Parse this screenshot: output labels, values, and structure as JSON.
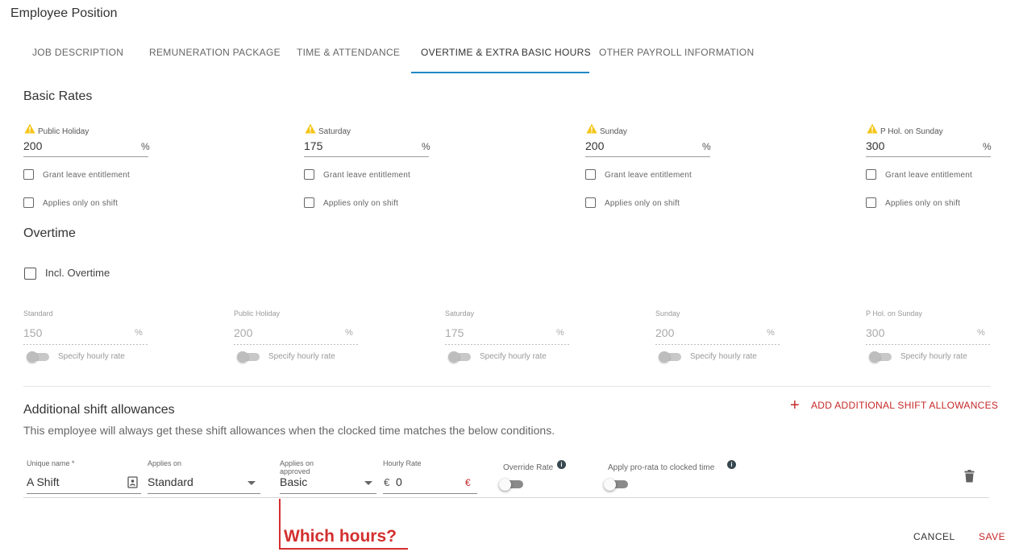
{
  "page": {
    "title": "Employee Position"
  },
  "tabs": [
    {
      "label": "JOB DESCRIPTION"
    },
    {
      "label": "REMUNERATION PACKAGE"
    },
    {
      "label": "TIME & ATTENDANCE"
    },
    {
      "label": "OVERTIME & EXTRA BASIC HOURS",
      "active": true
    },
    {
      "label": "OTHER PAYROLL INFORMATION"
    }
  ],
  "basic_rates": {
    "title": "Basic Rates",
    "unit": "%",
    "grant_label": "Grant leave entitlement",
    "shift_label": "Applies only on shift",
    "warning_icon": "warning-triangle-icon",
    "warning_color": "#f5c518",
    "fields": [
      {
        "label": "Public Holiday",
        "value": "200"
      },
      {
        "label": "Saturday",
        "value": "175"
      },
      {
        "label": "Sunday",
        "value": "200"
      },
      {
        "label": "P Hol. on Sunday",
        "value": "300"
      }
    ]
  },
  "overtime": {
    "title": "Overtime",
    "incl_label": "Incl. Overtime",
    "unit": "%",
    "toggle_label": "Specify hourly rate",
    "fields": [
      {
        "label": "Standard",
        "value": "150"
      },
      {
        "label": "Public Holiday",
        "value": "200"
      },
      {
        "label": "Saturday",
        "value": "175"
      },
      {
        "label": "Sunday",
        "value": "200"
      },
      {
        "label": "P Hol. on Sunday",
        "value": "300"
      }
    ]
  },
  "allowances": {
    "title": "Additional shift allowances",
    "description": "This employee will always get these shift allowances when the clocked time matches the below conditions.",
    "add_label": "ADD ADDITIONAL SHIFT ALLOWANCES",
    "accent_color": "#c62828",
    "row": {
      "unique_name_label": "Unique name *",
      "unique_name_value": "A Shift",
      "applies_on_label": "Applies on",
      "applies_on_value": "Standard",
      "applies_on_approved_label": "Applies on approved",
      "applies_on_approved_value": "Basic",
      "hourly_rate_label": "Hourly Rate",
      "hourly_rate_value": "0",
      "currency_symbol": "€",
      "override_rate_label": "Override Rate",
      "pro_rata_label": "Apply pro-rata to clocked time",
      "info_glyph": "i"
    }
  },
  "annotation": {
    "text": "Which hours?",
    "color": "#d32f2f"
  },
  "footer": {
    "cancel_label": "CANCEL",
    "save_label": "SAVE"
  }
}
